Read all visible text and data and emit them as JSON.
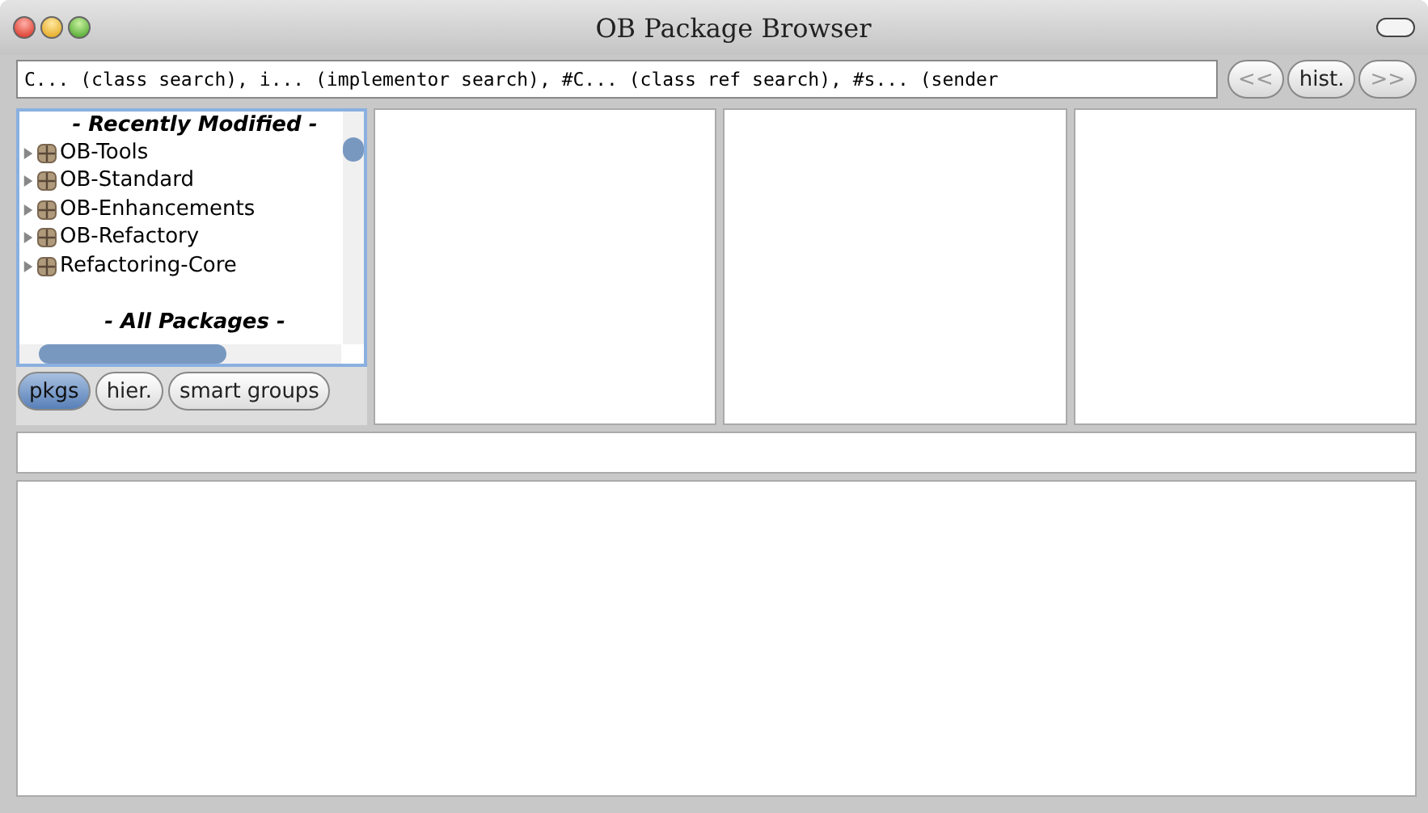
{
  "window": {
    "title": "OB Package Browser"
  },
  "search": {
    "value": "C... (class search), i... (implementor search), #C... (class ref search), #s... (sender"
  },
  "nav_buttons": [
    {
      "label": "<<",
      "disabled": true
    },
    {
      "label": "hist.",
      "disabled": false
    },
    {
      "label": ">>",
      "disabled": true
    }
  ],
  "package_list": {
    "sections": [
      {
        "heading": "- Recently Modified -",
        "items": [
          {
            "label": "OB-Tools",
            "expanded": false
          },
          {
            "label": "OB-Standard",
            "expanded": false
          },
          {
            "label": "OB-Enhancements",
            "expanded": false
          },
          {
            "label": "OB-Refactory",
            "expanded": false
          },
          {
            "label": "Refactoring-Core",
            "expanded": false
          }
        ]
      },
      {
        "heading": "- All Packages -"
      }
    ]
  },
  "mode_tabs": [
    {
      "label": "pkgs",
      "selected": true
    },
    {
      "label": "hier.",
      "selected": false
    },
    {
      "label": "smart groups",
      "selected": false
    }
  ]
}
